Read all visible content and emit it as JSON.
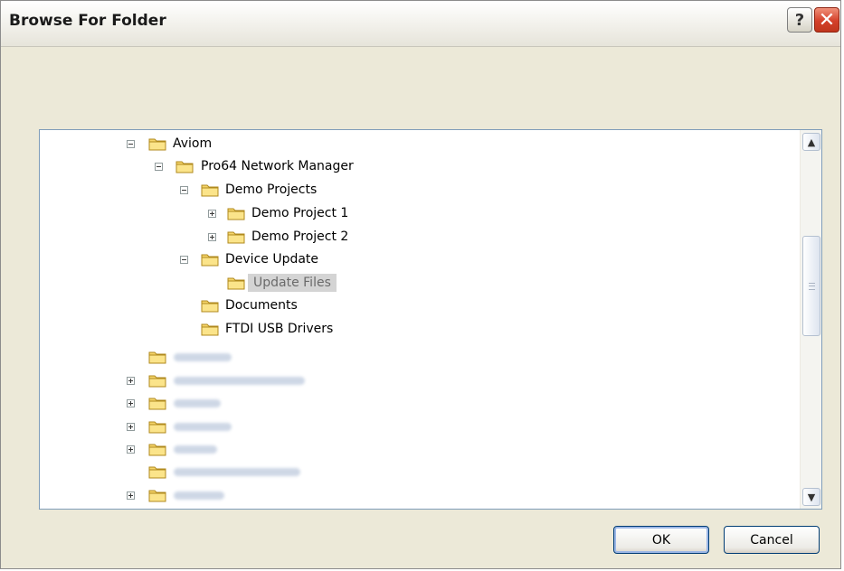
{
  "window": {
    "title": "Browse For Folder",
    "help_glyph": "?",
    "close_glyph": "✕"
  },
  "tree": {
    "items": [
      {
        "label": "Aviom",
        "expander": "minus"
      },
      {
        "label": "Pro64 Network Manager",
        "expander": "minus"
      },
      {
        "label": "Demo Projects",
        "expander": "minus"
      },
      {
        "label": "Demo Project 1",
        "expander": "plus"
      },
      {
        "label": "Demo Project 2",
        "expander": "plus"
      },
      {
        "label": "Device Update",
        "expander": "minus"
      },
      {
        "label": "Update Files",
        "expander": "none",
        "selected": true
      },
      {
        "label": "Documents",
        "expander": "none"
      },
      {
        "label": "FTDI USB Drivers",
        "expander": "none"
      }
    ]
  },
  "scrollbar": {
    "up_arrow": "▲",
    "down_arrow": "▼"
  },
  "buttons": {
    "ok_label": "OK",
    "cancel_label": "Cancel"
  },
  "colors": {
    "dialog_bg": "#ece9d8",
    "tree_border": "#7f9db9",
    "selection_bg": "#d4d4d4",
    "folder_fill": "#f5d469"
  }
}
